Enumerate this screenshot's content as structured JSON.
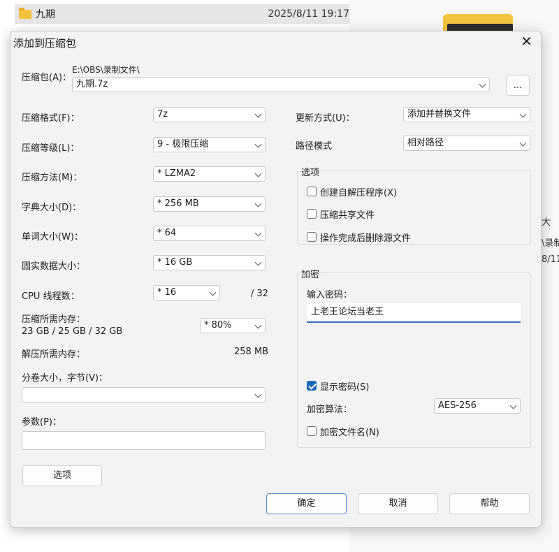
{
  "background": {
    "folder_name": "九期",
    "folder_date": "2025/8/11 19:17",
    "side_text_1": "大",
    "side_text_2": "\\录制",
    "side_text_3": "8/11"
  },
  "dialog": {
    "title": "添加到压缩包",
    "archive_label": "压缩包(A)：",
    "archive_path": "E:\\OBS\\录制文件\\",
    "archive_name": "九期.7z",
    "browse_label": "...",
    "left": {
      "format_label": "压缩格式(F)：",
      "format_value": "7z",
      "level_label": "压缩等级(L)：",
      "level_value": "9 - 极限压缩",
      "method_label": "压缩方法(M)：",
      "method_value": "* LZMA2",
      "dict_label": "字典大小(D)：",
      "dict_value": "* 256 MB",
      "word_label": "单词大小(W)：",
      "word_value": "* 64",
      "solid_label": "固实数据大小：",
      "solid_value": "* 16 GB",
      "threads_label": "CPU 线程数：",
      "threads_value": "* 16",
      "threads_max": "/ 32",
      "mem_label": "压缩所需内存：",
      "mem_values": "23 GB / 25 GB / 32 GB",
      "mem_percent": "* 80%",
      "decomp_label": "解压所需内存：",
      "decomp_value": "258 MB",
      "split_label": "分卷大小，字节(V)：",
      "split_value": "",
      "params_label": "参数(P)：",
      "params_value": "",
      "options_button": "选项"
    },
    "right": {
      "update_label": "更新方式(U)：",
      "update_value": "添加并替换文件",
      "path_label": "路径模式",
      "path_value": "相对路径",
      "options_group": "选项",
      "opt_sfx": "创建自解压程序(X)",
      "opt_shared": "压缩共享文件",
      "opt_delete": "操作完成后删除源文件",
      "encryption_group": "加密",
      "password_label": "输入密码：",
      "password_value": "上老王论坛当老王",
      "show_password": "显示密码(S)",
      "enc_method_label": "加密算法：",
      "enc_method_value": "AES-256",
      "enc_filenames": "加密文件名(N)"
    },
    "buttons": {
      "ok": "确定",
      "cancel": "取消",
      "help": "帮助"
    }
  },
  "colors": {
    "accent": "#1a67b5",
    "folder": "#f3c23e"
  }
}
